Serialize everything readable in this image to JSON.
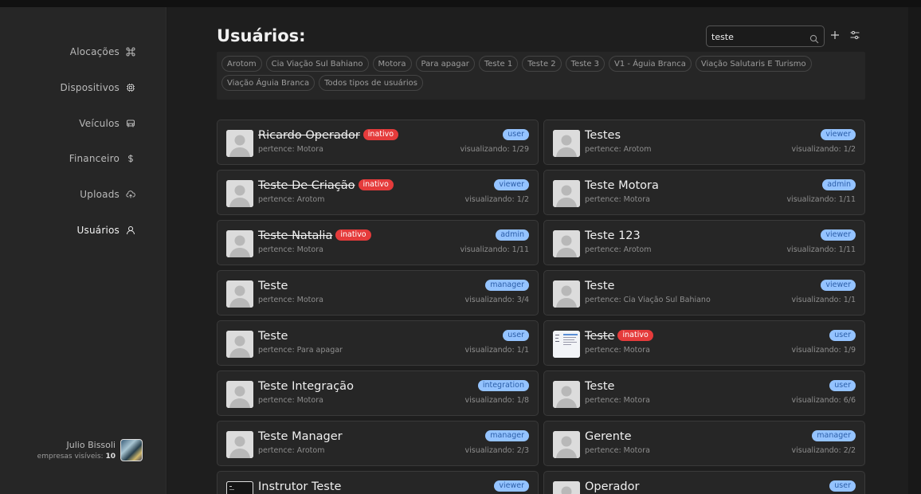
{
  "nav": [
    {
      "label": "Alocações",
      "icon": "command-icon",
      "active": false
    },
    {
      "label": "Dispositivos",
      "icon": "chip-icon",
      "active": false
    },
    {
      "label": "Veículos",
      "icon": "bus-icon",
      "active": false
    },
    {
      "label": "Financeiro",
      "icon": "dollar-icon",
      "active": false
    },
    {
      "label": "Uploads",
      "icon": "cloud-upload-icon",
      "active": false
    },
    {
      "label": "Usuários",
      "icon": "user-icon",
      "active": true
    }
  ],
  "current_user": {
    "name": "Julio Bissoli",
    "companies_label": "empresas visíveis:",
    "companies_count": "10"
  },
  "page": {
    "title": "Usuários:"
  },
  "search": {
    "value": "teste",
    "placeholder": ""
  },
  "filters": [
    "Arotom",
    "Cia Viação Sul Bahiano",
    "Motora",
    "Para apagar",
    "Teste 1",
    "Teste 2",
    "Teste 3",
    "V1 - Águia Branca",
    "Viação Salutaris E Turismo",
    "Viação Águia Branca",
    "Todos tipos de usuários"
  ],
  "colors": {
    "inactive": "#e53b3b",
    "role_badge_bg": "#94c3ff",
    "role_badge_text": "#2c5fa8"
  },
  "users": [
    {
      "name": "Ricardo Operador",
      "inactive": "inativo",
      "belongs": "pertence: Motora",
      "role": "user",
      "viewing": "visualizando: 1/29",
      "avatar": "placeholder"
    },
    {
      "name": "Testes",
      "inactive": null,
      "belongs": "pertence: Arotom",
      "role": "viewer",
      "viewing": "visualizando: 1/2",
      "avatar": "placeholder"
    },
    {
      "name": "Teste De Criação",
      "inactive": "inativo",
      "belongs": "pertence: Arotom",
      "role": "viewer",
      "viewing": "visualizando: 1/2",
      "avatar": "placeholder"
    },
    {
      "name": "Teste Motora",
      "inactive": null,
      "belongs": "pertence: Motora",
      "role": "admin",
      "viewing": "visualizando: 1/11",
      "avatar": "placeholder"
    },
    {
      "name": "Teste Natalia",
      "inactive": "inativo",
      "belongs": "pertence: Motora",
      "role": "admin",
      "viewing": "visualizando: 1/11",
      "avatar": "placeholder"
    },
    {
      "name": "Teste 123",
      "inactive": null,
      "belongs": "pertence: Arotom",
      "role": "viewer",
      "viewing": "visualizando: 1/11",
      "avatar": "placeholder"
    },
    {
      "name": "Teste",
      "inactive": null,
      "belongs": "pertence: Motora",
      "role": "manager",
      "viewing": "visualizando: 3/4",
      "avatar": "placeholder"
    },
    {
      "name": "Teste",
      "inactive": null,
      "belongs": "pertence: Cia Viação Sul Bahiano",
      "role": "viewer",
      "viewing": "visualizando: 1/1",
      "avatar": "placeholder"
    },
    {
      "name": "Teste",
      "inactive": null,
      "belongs": "pertence: Para apagar",
      "role": "user",
      "viewing": "visualizando: 1/1",
      "avatar": "placeholder"
    },
    {
      "name": "Teste",
      "inactive": "inativo",
      "belongs": "pertence: Motora",
      "role": "user",
      "viewing": "visualizando: 1/9",
      "avatar": "screenshot"
    },
    {
      "name": "Teste Integração",
      "inactive": null,
      "belongs": "pertence: Motora",
      "role": "integration",
      "viewing": "visualizando: 1/8",
      "avatar": "placeholder"
    },
    {
      "name": "Teste",
      "inactive": null,
      "belongs": "pertence: Motora",
      "role": "user",
      "viewing": "visualizando: 6/6",
      "avatar": "placeholder"
    },
    {
      "name": "Teste Manager",
      "inactive": null,
      "belongs": "pertence: Arotom",
      "role": "manager",
      "viewing": "visualizando: 2/3",
      "avatar": "placeholder"
    },
    {
      "name": "Gerente",
      "inactive": null,
      "belongs": "pertence: Motora",
      "role": "manager",
      "viewing": "visualizando: 2/2",
      "avatar": "placeholder"
    },
    {
      "name": "Instrutor Teste",
      "inactive": null,
      "belongs": "",
      "role": "viewer",
      "viewing": "",
      "avatar": "terminal"
    },
    {
      "name": "Operador",
      "inactive": null,
      "belongs": "",
      "role": "user",
      "viewing": "",
      "avatar": "placeholder"
    }
  ]
}
